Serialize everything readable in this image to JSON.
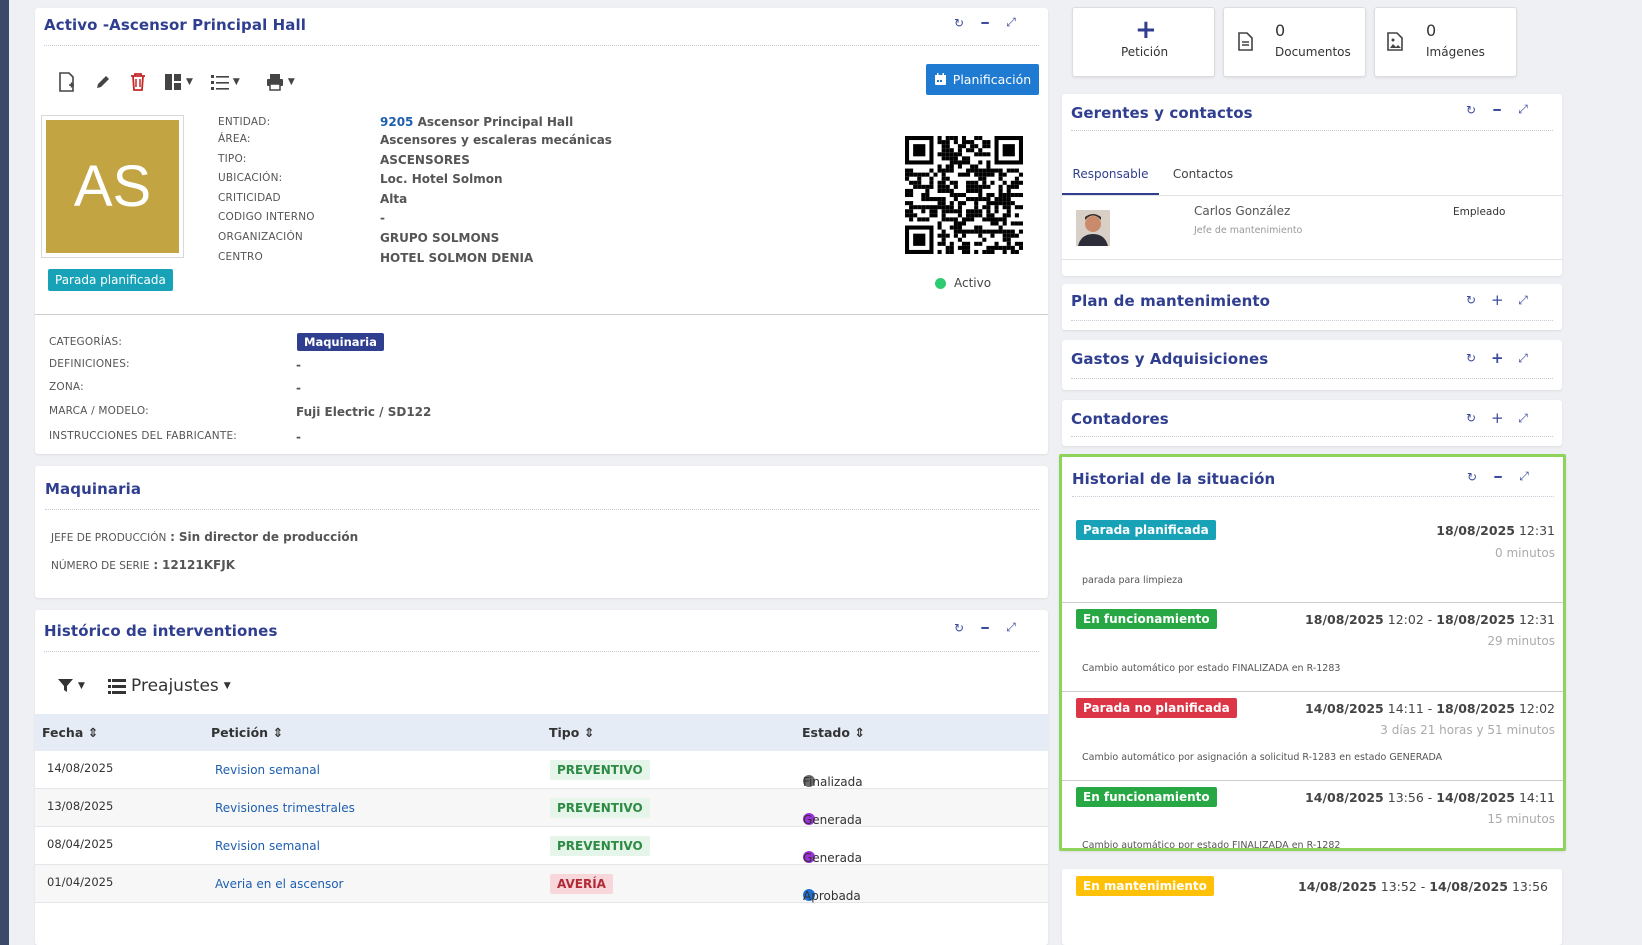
{
  "asset": {
    "title": "Activo -Ascensor Principal Hall",
    "planning_label": "Planificación",
    "avatar_initials": "AS",
    "status_tag": "Parada planificada",
    "qr_status": "Activo",
    "fields": [
      {
        "label": "ENTIDAD:",
        "value_num": "9205",
        "value": "Ascensor Principal Hall"
      },
      {
        "label": "ÁREA:",
        "value": "Ascensores y escaleras mecánicas"
      },
      {
        "label": "TIPO:",
        "value": "ASCENSORES"
      },
      {
        "label": "UBICACIÓN:",
        "value": "Loc. Hotel Solmon"
      },
      {
        "label": "CRITICIDAD",
        "value": "Alta"
      },
      {
        "label": "CODIGO INTERNO",
        "value": "-"
      },
      {
        "label": "ORGANIZACIÓN",
        "value": "GRUPO SOLMONS"
      },
      {
        "label": "CENTRO",
        "value": "HOTEL SOLMON DENIA"
      }
    ],
    "extra": [
      {
        "label": "CATEGORÍAS:",
        "value": "Maquinaria"
      },
      {
        "label": "DEFINICIONES:",
        "value": "-"
      },
      {
        "label": "ZONA:",
        "value": "-"
      },
      {
        "label": "MARCA / MODELO:",
        "value": "Fuji Electric / SD122"
      },
      {
        "label": "INSTRUCCIONES DEL FABRICANTE:",
        "value": "-"
      }
    ]
  },
  "maquinaria": {
    "title": "Maquinaria",
    "jefe_label": "JEFE DE PRODUCCIÓN",
    "jefe_value": "Sin director de producción",
    "serie_label": "NÚMERO DE SERIE",
    "serie_value": "12121KFJK",
    "sep": ":"
  },
  "historico": {
    "title": "Histórico de interventiones",
    "presets": "Preajustes",
    "columns": [
      "Fecha",
      "Petición",
      "Tipo",
      "Estado"
    ],
    "rows": [
      {
        "fecha": "14/08/2025",
        "peticion": "Revision semanal",
        "tipo": "PREVENTIVO",
        "estado": "Finalizada"
      },
      {
        "fecha": "13/08/2025",
        "peticion": "Revisiones trimestrales",
        "tipo": "PREVENTIVO",
        "estado": "Generada"
      },
      {
        "fecha": "08/04/2025",
        "peticion": "Revision semanal",
        "tipo": "PREVENTIVO",
        "estado": "Generada"
      },
      {
        "fecha": "01/04/2025",
        "peticion": "Averia en el ascensor",
        "tipo": "AVERÍA",
        "estado": "Aprobada"
      }
    ]
  },
  "top_cards": [
    {
      "icon": "plus-icon",
      "count": "",
      "label": "Petición"
    },
    {
      "icon": "document-icon",
      "count": "0",
      "label": "Documentos"
    },
    {
      "icon": "image-icon",
      "count": "0",
      "label": "Imágenes"
    }
  ],
  "gerentes": {
    "title": "Gerentes y contactos",
    "tabs": [
      "Responsable",
      "Contactos"
    ],
    "person_name": "Carlos González",
    "person_role": "Jefe de mantenimiento",
    "person_type": "Empleado"
  },
  "plan": {
    "title": "Plan de mantenimiento"
  },
  "gastos": {
    "title": "Gastos y Adquisiciones"
  },
  "contadores": {
    "title": "Contadores"
  },
  "historial": {
    "title": "Historial de la situación",
    "entries": [
      {
        "tag": "Parada planificada",
        "color": "#17a2b8",
        "start_date": "18/08/2025",
        "start_time": "12:31",
        "end_date": "",
        "end_time": "",
        "duration": "0 minutos",
        "note": "parada para limpieza"
      },
      {
        "tag": "En funcionamiento",
        "color": "#28a745",
        "start_date": "18/08/2025",
        "start_time": "12:02",
        "end_date": "18/08/2025",
        "end_time": "12:31",
        "duration": "29 minutos",
        "note": "Cambio automático por estado FINALIZADA en R-1283"
      },
      {
        "tag": "Parada no planificada",
        "color": "#dc3545",
        "start_date": "14/08/2025",
        "start_time": "14:11",
        "end_date": "18/08/2025",
        "end_time": "12:02",
        "duration": "3 días 21 horas y 51 minutos",
        "note": "Cambio automático por asignación a solicitud R-1283 en estado GENERADA"
      },
      {
        "tag": "En funcionamiento",
        "color": "#28a745",
        "start_date": "14/08/2025",
        "start_time": "13:56",
        "end_date": "14/08/2025",
        "end_time": "14:11",
        "duration": "15 minutos",
        "note": "Cambio automático por estado FINALIZADA en R-1282"
      },
      {
        "tag": "En mantenimiento",
        "color": "#ffc107",
        "start_date": "14/08/2025",
        "start_time": "13:52",
        "end_date": "14/08/2025",
        "end_time": "13:56",
        "duration": "",
        "note": ""
      }
    ],
    "dash": "-"
  },
  "colors": {
    "accent": "#2f3e8f",
    "primary_button": "#1f7ad1",
    "highlight_border": "#8ed35a"
  }
}
